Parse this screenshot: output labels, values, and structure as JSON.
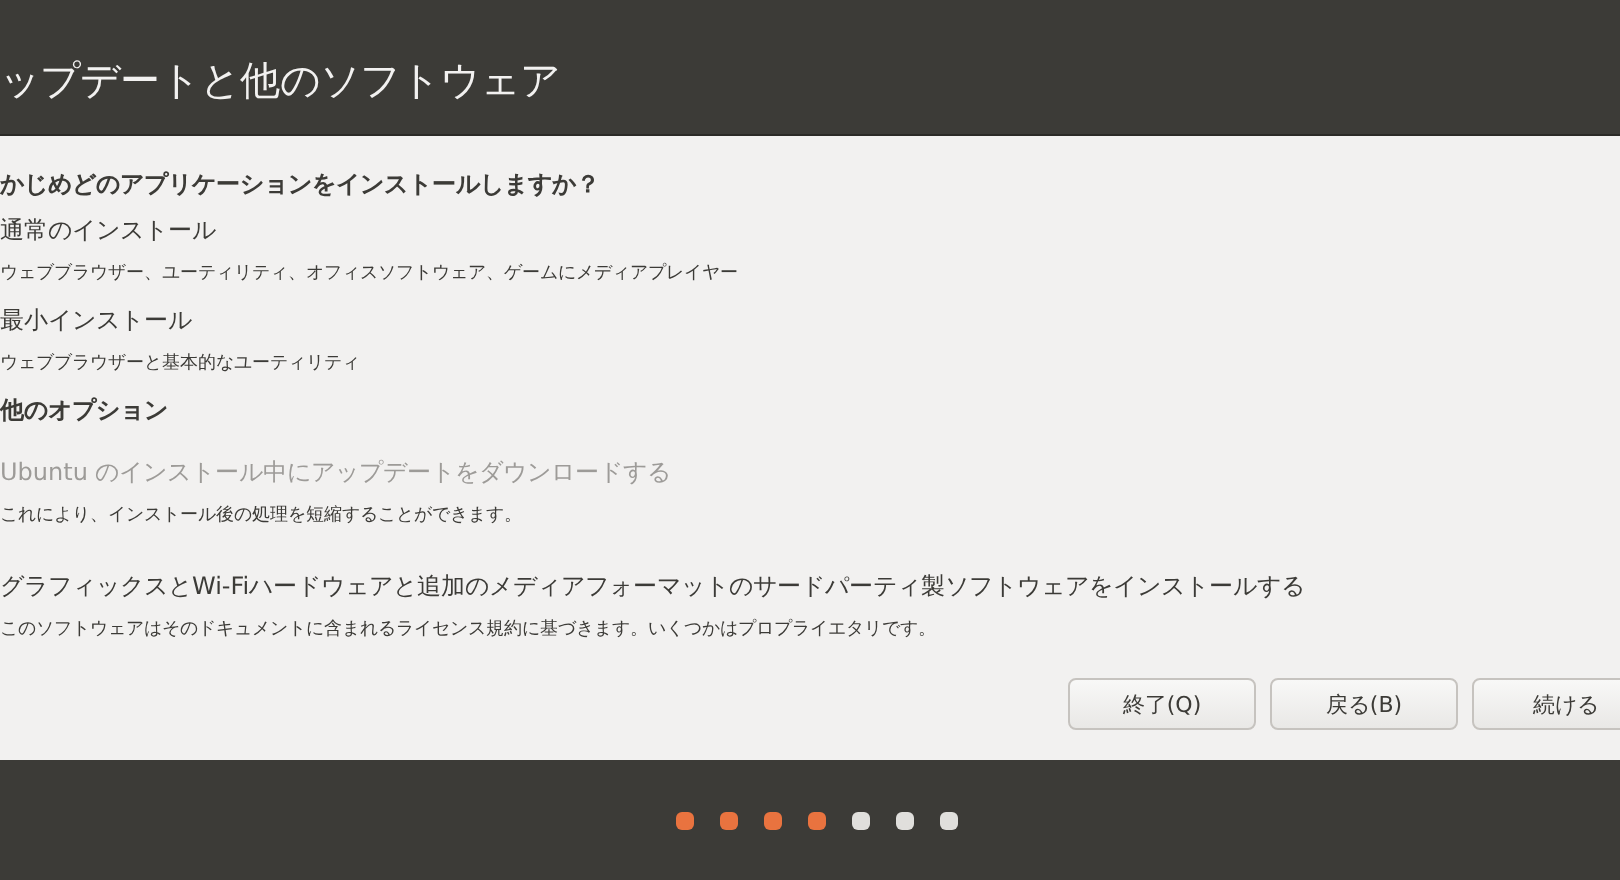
{
  "header": {
    "title": "ップデートと他のソフトウェア"
  },
  "question": "かじめどのアプリケーションをインストールしますか？",
  "install_options": [
    {
      "label": "通常のインストール",
      "description": "ウェブブラウザー、ユーティリティ、オフィスソフトウェア、ゲームにメディアプレイヤー"
    },
    {
      "label": "最小インストール",
      "description": "ウェブブラウザーと基本的なユーティリティ"
    }
  ],
  "other_heading": "他のオプション",
  "other_options": [
    {
      "label": "Ubuntu のインストール中にアップデートをダウンロードする",
      "description": "これにより、インストール後の処理を短縮することができます。",
      "disabled": true
    },
    {
      "label": "グラフィックスとWi-Fiハードウェアと追加のメディアフォーマットのサードパーティ製ソフトウェアをインストールする",
      "description": "このソフトウェアはそのドキュメントに含まれるライセンス規約に基づきます。いくつかはプロプライエタリです。",
      "disabled": false
    }
  ],
  "buttons": [
    "終了(Q)",
    "戻る(B)",
    "続ける"
  ],
  "progress_steps": [
    {
      "done": true
    },
    {
      "done": true
    },
    {
      "done": true
    },
    {
      "done": true
    },
    {
      "done": false
    },
    {
      "done": false
    },
    {
      "done": false
    }
  ]
}
